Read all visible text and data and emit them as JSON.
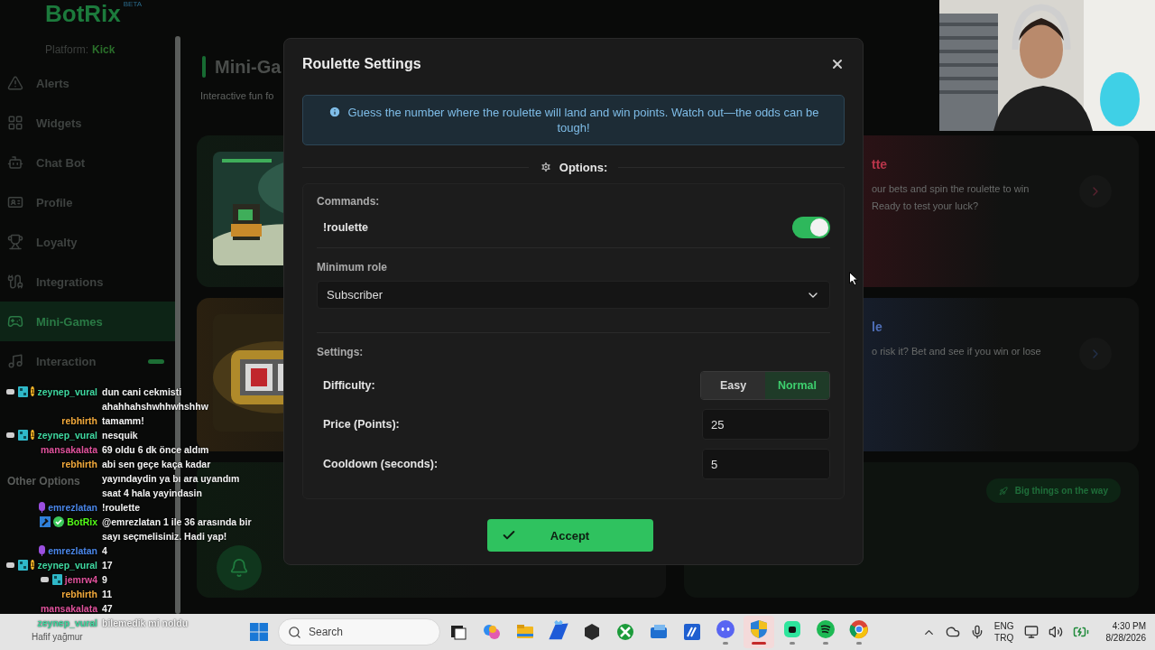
{
  "app": {
    "logo": "BotRix",
    "badge": "BETA",
    "platform_label": "Platform:",
    "platform": "Kick"
  },
  "sidebar": {
    "items": [
      {
        "label": "Alerts",
        "selected": false
      },
      {
        "label": "Widgets",
        "selected": false
      },
      {
        "label": "Chat Bot",
        "selected": false
      },
      {
        "label": "Profile",
        "selected": false
      },
      {
        "label": "Loyalty",
        "selected": false
      },
      {
        "label": "Integrations",
        "selected": false
      },
      {
        "label": "Mini-Games",
        "selected": true
      },
      {
        "label": "Interaction",
        "selected": false
      }
    ],
    "section": "Other Options"
  },
  "page": {
    "title": "Mini-Ga",
    "subtitle": "Interactive fun fo"
  },
  "right_cards": [
    {
      "title": "tte",
      "description": "our bets and spin the roulette to win\nReady to test your luck?",
      "color": "#b8354a"
    },
    {
      "title": "le",
      "description": "o risk it? Bet and see if you win or lose",
      "color": "#4f6fb8"
    }
  ],
  "banner": "Big things on the way",
  "modal": {
    "title": "Roulette Settings",
    "info": "Guess the number where the roulette will land and win points. Watch out—the odds can be tough!",
    "options_heading": "Options:",
    "commands_label": "Commands:",
    "command": {
      "label": "!roulette",
      "on": true
    },
    "min_role": {
      "label": "Minimum role",
      "value": "Subscriber"
    },
    "settings_label": "Settings:",
    "difficulty": {
      "label": "Difficulty:",
      "options": [
        {
          "label": "Easy",
          "selected": false
        },
        {
          "label": "Normal",
          "selected": true
        }
      ]
    },
    "fields": [
      {
        "label": "Price (Points):",
        "value": "25"
      },
      {
        "label": "Cooldown (seconds):",
        "value": "5"
      }
    ],
    "accept": "Accept"
  },
  "chat": [
    {
      "user": "zeynep_vural",
      "color": "#3fd8a0",
      "badges": [
        {
          "kind": "gift"
        },
        {
          "kind": "sub"
        },
        {
          "kind": "level",
          "text": "1"
        }
      ],
      "text": "dun cani cekmisti ahahhahshwhhwhshhw"
    },
    {
      "user": "rebhirth",
      "color": "#f2a93b",
      "text": "tamamm!"
    },
    {
      "user": "zeynep_vural",
      "color": "#3fd8a0",
      "badges": [
        {
          "kind": "gift"
        },
        {
          "kind": "sub"
        },
        {
          "kind": "level",
          "text": "1"
        }
      ],
      "text": "nesquik"
    },
    {
      "user": "mansakalata",
      "color": "#e0529c",
      "text": "69 oldu 6 dk önce aldım"
    },
    {
      "user": "rebhirth",
      "color": "#f2a93b",
      "text": "abi sen geçe kaça kadar yayındaydin ya bı ara uyandım saat 4 hala yayindasin"
    },
    {
      "user": "emrezlatan",
      "color": "#4a86e8",
      "badges": [
        {
          "kind": "mic"
        }
      ],
      "text": "!roulette"
    },
    {
      "user": "BotRix",
      "color": "#53fc18",
      "badges": [
        {
          "kind": "mod"
        },
        {
          "kind": "verified"
        }
      ],
      "text": "@emrezlatan 1 ile 36 arasında bir sayı seçmelisiniz. Hadi yap!"
    },
    {
      "user": "emrezlatan",
      "color": "#4a86e8",
      "badges": [
        {
          "kind": "mic"
        }
      ],
      "text": "4"
    },
    {
      "user": "zeynep_vural",
      "color": "#3fd8a0",
      "badges": [
        {
          "kind": "gift"
        },
        {
          "kind": "sub"
        },
        {
          "kind": "level",
          "text": "1"
        }
      ],
      "text": "17"
    },
    {
      "user": "jemrw4",
      "color": "#e0529c",
      "badges": [
        {
          "kind": "gift"
        },
        {
          "kind": "sub"
        }
      ],
      "text": "9"
    },
    {
      "user": "rebhirth",
      "color": "#f2a93b",
      "text": "11"
    },
    {
      "user": "mansakalata",
      "color": "#e0529c",
      "text": "47"
    },
    {
      "user": "zeynep_vural",
      "color": "#3fd8a0",
      "text": "bilemedik mi noldu"
    }
  ],
  "taskbar": {
    "weather": "Hafif yağmur",
    "search_placeholder": "Search",
    "apps": [
      {
        "open": false,
        "selected": false
      },
      {
        "open": false,
        "selected": false
      },
      {
        "open": false,
        "selected": false
      },
      {
        "open": false,
        "selected": false
      },
      {
        "open": false,
        "selected": false
      },
      {
        "open": false,
        "selected": false
      },
      {
        "open": false,
        "selected": false
      },
      {
        "open": false,
        "selected": false
      },
      {
        "open": true,
        "selected": false
      },
      {
        "open": true,
        "selected": true
      },
      {
        "open": true,
        "selected": false
      },
      {
        "open": true,
        "selected": false
      },
      {
        "open": true,
        "selected": false
      }
    ],
    "language": "ENG",
    "layout": "TRQ",
    "time": "4:30 PM",
    "date": "8/28/2026"
  }
}
